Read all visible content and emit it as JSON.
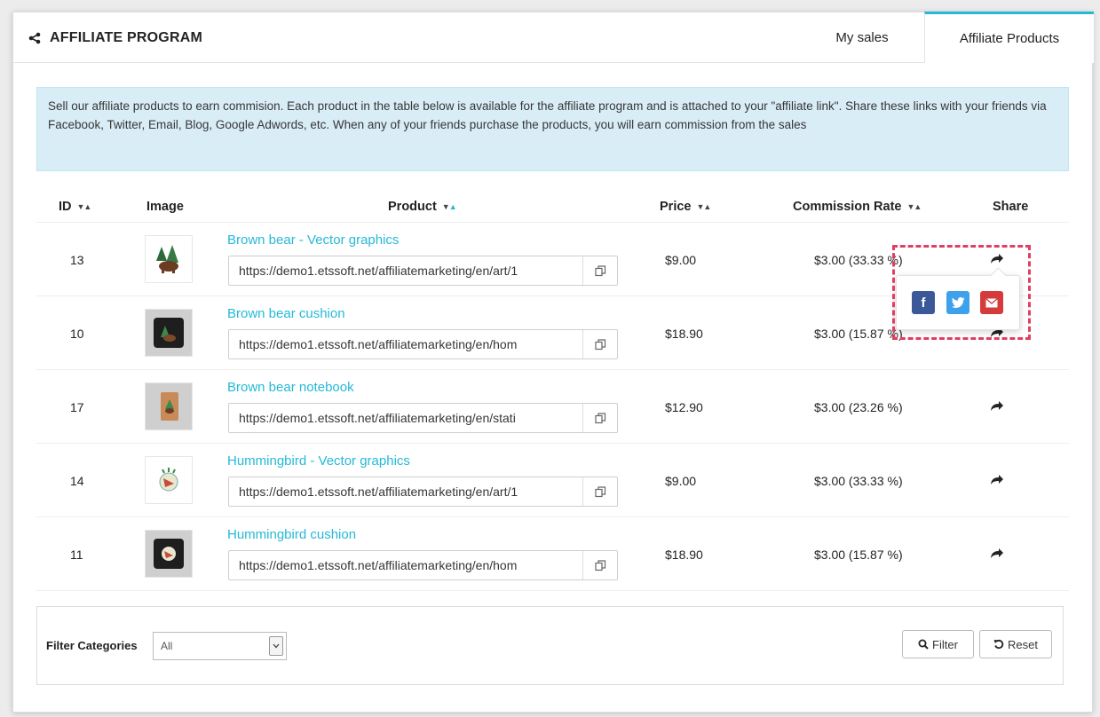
{
  "header": {
    "title": "AFFILIATE PROGRAM",
    "tabs": [
      {
        "label": "My sales",
        "active": false
      },
      {
        "label": "Affiliate Products",
        "active": true
      }
    ]
  },
  "info_text": "Sell our affiliate products to earn commision. Each product in the table below is available for the affiliate program and is attached to your \"affiliate link\". Share these links with your friends via Facebook, Twitter, Email, Blog, Google Adwords, etc. When any of your friends purchase the products, you will earn commission from the sales",
  "table": {
    "columns": [
      "ID",
      "Image",
      "Product",
      "Price",
      "Commission Rate",
      "Share"
    ],
    "rows": [
      {
        "id": "13",
        "product": "Brown bear - Vector graphics",
        "url": "https://demo1.etssoft.net/affiliatemarketing/en/art/1",
        "price": "$9.00",
        "commission": "$3.00 (33.33 %)"
      },
      {
        "id": "10",
        "product": "Brown bear cushion",
        "url": "https://demo1.etssoft.net/affiliatemarketing/en/hom",
        "price": "$18.90",
        "commission": "$3.00 (15.87 %)"
      },
      {
        "id": "17",
        "product": "Brown bear notebook",
        "url": "https://demo1.etssoft.net/affiliatemarketing/en/stati",
        "price": "$12.90",
        "commission": "$3.00 (23.26 %)"
      },
      {
        "id": "14",
        "product": "Hummingbird - Vector graphics",
        "url": "https://demo1.etssoft.net/affiliatemarketing/en/art/1",
        "price": "$9.00",
        "commission": "$3.00 (33.33 %)"
      },
      {
        "id": "11",
        "product": "Hummingbird cushion",
        "url": "https://demo1.etssoft.net/affiliatemarketing/en/hom",
        "price": "$18.90",
        "commission": "$3.00 (15.87 %)"
      }
    ]
  },
  "share_popup": {
    "facebook": "f",
    "twitter": "twitter-icon",
    "email": "email-icon"
  },
  "filter": {
    "label": "Filter Categories",
    "selected": "All",
    "filter_button": "Filter",
    "reset_button": "Reset"
  },
  "colors": {
    "accent": "#25b9d7",
    "info_bg": "#d9edf7",
    "highlight": "#e03e62",
    "facebook": "#3b5998",
    "twitter": "#3ea1ec",
    "email": "#d63b3b"
  }
}
